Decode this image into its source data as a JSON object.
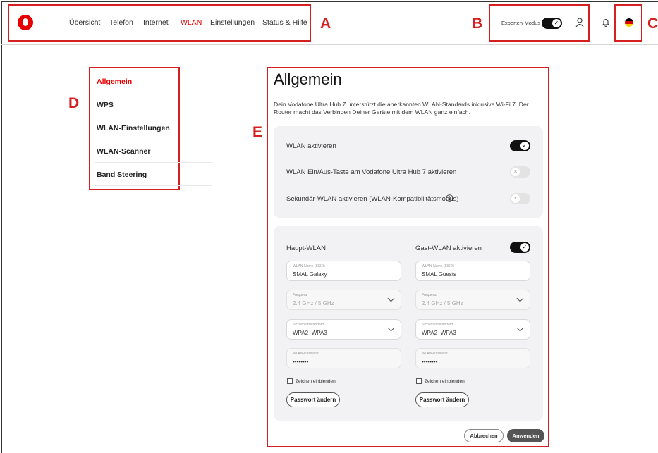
{
  "header": {
    "nav": [
      "Übersicht",
      "Telefon",
      "Internet",
      "WLAN",
      "Einstellungen",
      "Status & Hilfe"
    ],
    "expert_mode_label": "Experten-Modus"
  },
  "annotations": [
    "A",
    "B",
    "C",
    "D",
    "E"
  ],
  "sidebar": {
    "items": [
      {
        "label": "Allgemein",
        "active": true
      },
      {
        "label": "WPS"
      },
      {
        "label": "WLAN-Einstellungen"
      },
      {
        "label": "WLAN-Scanner"
      },
      {
        "label": "Band Steering"
      }
    ]
  },
  "main": {
    "title": "Allgemein",
    "description": "Dein Vodafone Ultra Hub 7 unterstützt die anerkannten WLAN-Standards inklusive Wi-Fi 7. Der Router macht das Verbinden Deiner Geräte mit dem WLAN ganz einfach.",
    "toggles": [
      {
        "label": "WLAN aktivieren",
        "state": "on"
      },
      {
        "label": "WLAN Ein/Aus-Taste am Vodafone Ultra Hub 7 aktivieren",
        "state": "off"
      },
      {
        "label": "Sekundär-WLAN aktivieren (WLAN-Kompatibilitätsmodus)",
        "state": "off"
      }
    ],
    "main_wlan": {
      "heading": "Haupt-WLAN",
      "ssid_label": "WLAN-Name (SSID)",
      "ssid": "SMAL Galaxy",
      "freq_label": "Frequenz",
      "freq": "2.4 GHz / 5 GHz",
      "sec_label": "Sicherheitsstandard",
      "sec": "WPA2+WPA3",
      "pw_label": "WLAN-Passwort",
      "pw": "••••••••",
      "show_chars": "Zeichen einblenden",
      "change_pw": "Passwort ändern"
    },
    "guest_wlan": {
      "heading": "Gast-WLAN aktivieren",
      "state": "on",
      "ssid_label": "WLAN-Name (SSID)",
      "ssid": "SMAL Guests",
      "freq_label": "Frequenz",
      "freq": "2.4 GHz / 5 GHz",
      "sec_label": "Sicherheitsstandard",
      "sec": "WPA2+WPA3",
      "pw_label": "WLAN-Passwort",
      "pw": "••••••••",
      "show_chars": "Zeichen einblenden",
      "change_pw": "Passwort ändern"
    },
    "cancel": "Abbrechen",
    "apply": "Anwenden"
  },
  "colors": {
    "accent": "#e60000",
    "annotation": "#d42020"
  }
}
